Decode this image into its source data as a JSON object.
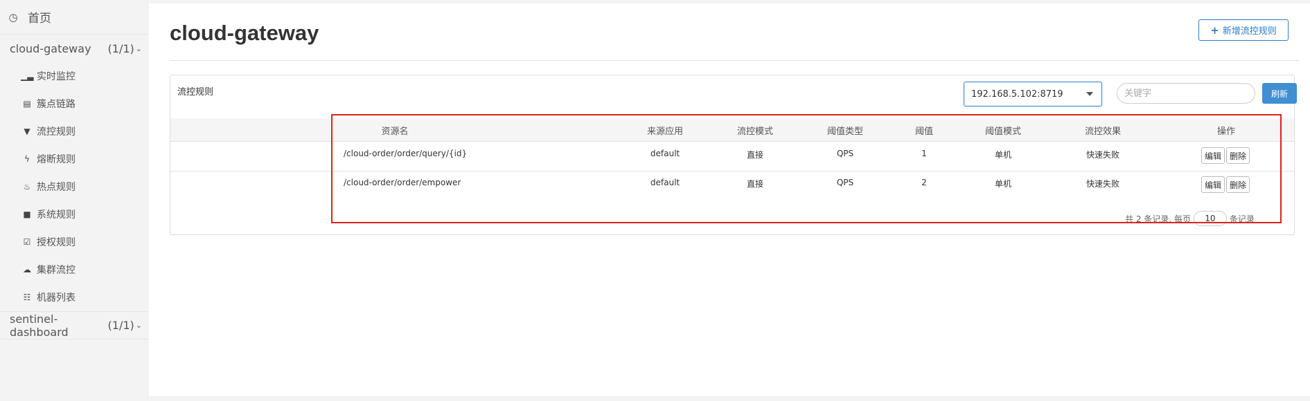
{
  "sidebar": {
    "home_label": "首页",
    "home_icon": "clock-icon",
    "apps": [
      {
        "name": "cloud-gateway",
        "count": "(1/1)",
        "items": [
          {
            "label": "实时监控",
            "icon": "bar-chart-icon"
          },
          {
            "label": "簇点链路",
            "icon": "list-icon"
          },
          {
            "label": "流控规则",
            "icon": "filter-icon"
          },
          {
            "label": "熔断规则",
            "icon": "bolt-icon"
          },
          {
            "label": "热点规则",
            "icon": "fire-icon"
          },
          {
            "label": "系统规则",
            "icon": "lock-icon"
          },
          {
            "label": "授权规则",
            "icon": "check-icon"
          },
          {
            "label": "集群流控",
            "icon": "cloud-icon"
          },
          {
            "label": "机器列表",
            "icon": "th-list-icon"
          }
        ]
      },
      {
        "name": "sentinel-dashboard",
        "count": "(1/1)"
      }
    ]
  },
  "header": {
    "title": "cloud-gateway",
    "add_button": "新增流控规则"
  },
  "panel": {
    "title": "流控规则",
    "machine_selected": "192.168.5.102:8719",
    "search_placeholder": "关键字",
    "refresh_label": "刷新"
  },
  "table": {
    "columns": [
      "资源名",
      "来源应用",
      "流控模式",
      "阈值类型",
      "阈值",
      "阈值模式",
      "流控效果",
      "操作"
    ],
    "rows": [
      {
        "resource": "/cloud-order/order/query/{id}",
        "limitApp": "default",
        "mode": "直接",
        "grade": "QPS",
        "count": "1",
        "clusterMode": "单机",
        "effect": "快速失败"
      },
      {
        "resource": "/cloud-order/order/empower",
        "limitApp": "default",
        "mode": "直接",
        "grade": "QPS",
        "count": "2",
        "clusterMode": "单机",
        "effect": "快速失败"
      }
    ],
    "edit_label": "编辑",
    "delete_label": "删除"
  },
  "pager": {
    "prefix": "共 2 条记录, 每页",
    "page_size": "10",
    "suffix": "条记录"
  },
  "colors": {
    "accent": "#2f7bbf",
    "refresh": "#3f8fd2",
    "highlight": "#e02020"
  }
}
